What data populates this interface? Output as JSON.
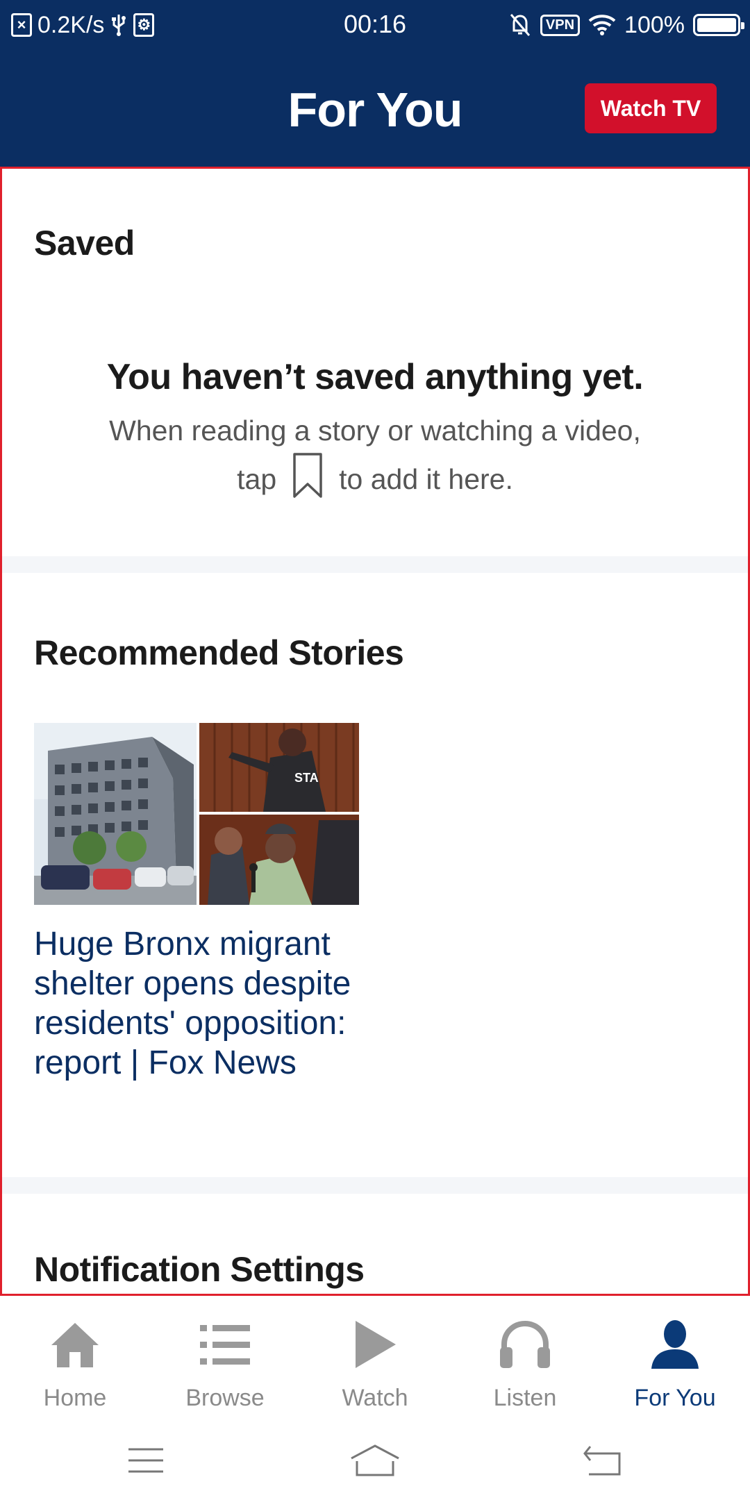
{
  "status_bar": {
    "network_speed": "0.2K/s",
    "time": "00:16",
    "vpn": "VPN",
    "battery": "100%",
    "icons": [
      "x-box-icon",
      "usb-icon",
      "debug-icon",
      "bell-off-icon",
      "vpn-icon",
      "wifi-icon",
      "battery-icon"
    ]
  },
  "header": {
    "title": "For You",
    "watch_tv_label": "Watch TV",
    "colors": {
      "header_bg": "#0b2e62",
      "watch_tv_bg": "#d2102b"
    }
  },
  "saved": {
    "title": "Saved",
    "empty_heading": "You haven’t saved anything yet.",
    "empty_line1": "When reading a story or watching a video,",
    "empty_line2_before": "tap",
    "empty_line2_after": "to add it here.",
    "icon": "bookmark-icon"
  },
  "recommended": {
    "title": "Recommended Stories",
    "stories": [
      {
        "title": "Huge Bronx migrant shelter opens despite residents' opposition: report | Fox News",
        "thumbnail_text": "STA"
      }
    ]
  },
  "notifications": {
    "title": "Notification Settings"
  },
  "bottom_nav": {
    "items": [
      {
        "label": "Home",
        "icon": "home-icon",
        "active": false
      },
      {
        "label": "Browse",
        "icon": "list-icon",
        "active": false
      },
      {
        "label": "Watch",
        "icon": "play-icon",
        "active": false
      },
      {
        "label": "Listen",
        "icon": "headphones-icon",
        "active": false
      },
      {
        "label": "For You",
        "icon": "person-icon",
        "active": true
      }
    ],
    "active_color": "#0b3a78",
    "inactive_color": "#8a8a8a"
  },
  "system_nav": {
    "icons": [
      "menu-icon",
      "home-outline-icon",
      "back-icon"
    ]
  }
}
